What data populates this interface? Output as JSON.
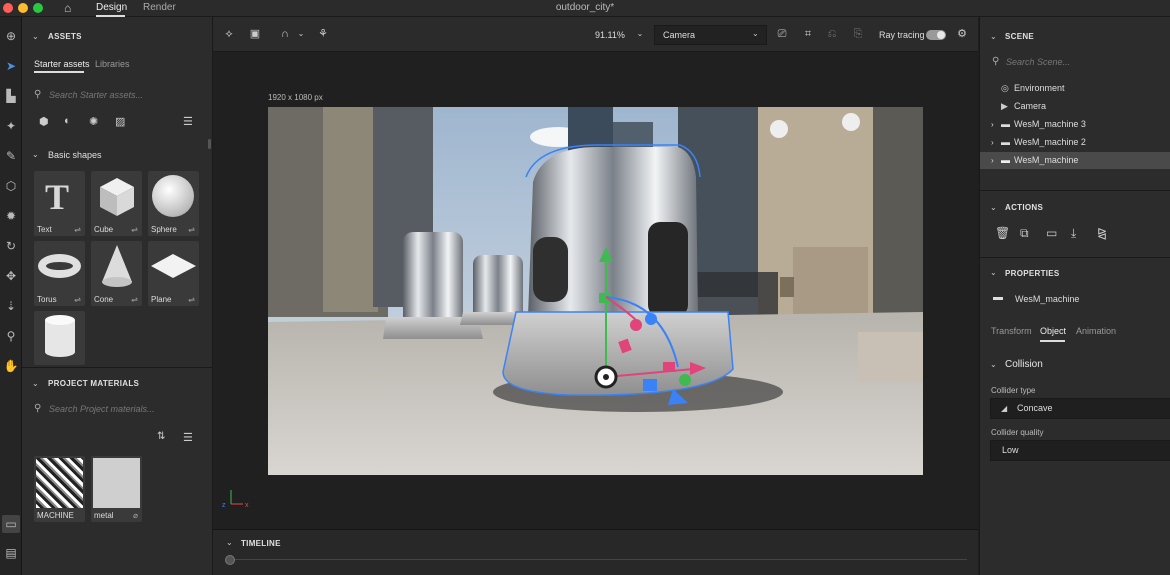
{
  "window": {
    "title": "outdoor_city*"
  },
  "topbar": {
    "tabs": [
      "Design",
      "Render"
    ]
  },
  "left_panel": {
    "assets_title": "ASSETS",
    "asset_tabs": [
      "Starter assets",
      "Libraries"
    ],
    "search_placeholder": "Search Starter assets...",
    "basic_shapes_title": "Basic shapes",
    "shapes": [
      "Text",
      "Cube",
      "Sphere",
      "Torus",
      "Cone",
      "Plane",
      ""
    ],
    "project_materials_title": "PROJECT MATERIALS",
    "materials_search_placeholder": "Search Project materials...",
    "materials": [
      "MACHINE",
      "metal"
    ]
  },
  "toolbar": {
    "zoom": "91.11%",
    "camera": "Camera",
    "ray_tracing_label": "Ray tracing",
    "ray_tracing_on": true
  },
  "viewport": {
    "resolution": "1920 x 1080 px"
  },
  "timeline": {
    "title": "TIMELINE"
  },
  "right_panel": {
    "scene_title": "SCENE",
    "scene_search_placeholder": "Search Scene...",
    "tree": [
      "Environment",
      "Camera",
      "WesM_machine 3",
      "WesM_machine 2",
      "WesM_machine"
    ],
    "actions_title": "ACTIONS",
    "properties_title": "PROPERTIES",
    "object_name": "WesM_machine",
    "prop_tabs": [
      "Transform",
      "Object",
      "Animation"
    ],
    "collision_title": "Collision",
    "collider_type_label": "Collider type",
    "collider_type": "Concave",
    "collider_quality_label": "Collider quality",
    "collider_quality": "Low"
  },
  "colors": {
    "accent": "#3b82f6",
    "selected_row": "#4a4a4a",
    "panel": "#2c2c2c"
  }
}
